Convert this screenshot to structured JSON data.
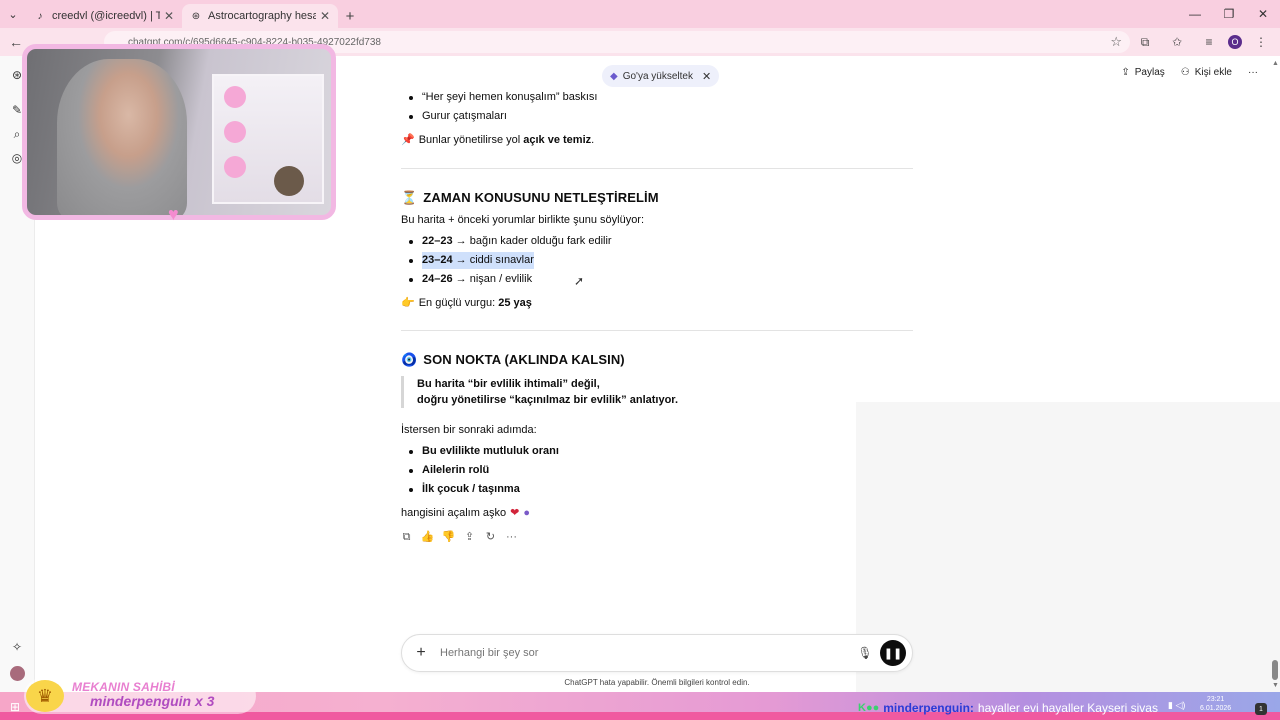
{
  "browser": {
    "tabs": [
      {
        "title": "creedvl (@icreedvl) | TikTok",
        "icon": "tiktok-icon",
        "active": false
      },
      {
        "title": "Astrocartography hesaplama y",
        "icon": "chatgpt-icon",
        "active": true
      }
    ],
    "url": "chatgpt.com/c/695d6645-c904-8224-b035-4927022fd738",
    "profile_letter": "O"
  },
  "header": {
    "upgrade_label": "Go'ya yükseltek",
    "share_label": "Paylaş",
    "add_person_label": "Kişi ekle"
  },
  "content": {
    "pre_bullets": [
      "“Her şeyi hemen konuşalım” baskısı",
      "Gurur çatışmaları"
    ],
    "managed_prefix": "Bunlar yönetilirse yol ",
    "managed_bold": "açık ve temiz",
    "managed_suffix": ".",
    "time_heading": "ZAMAN KONUSUNU NETLEŞTİRELİM",
    "time_intro": "Bu harita + önceki yorumlar birlikte şunu söylüyor:",
    "time_items": [
      {
        "range": "22–23",
        "text": "→ bağın kader olduğu fark edilir"
      },
      {
        "range": "23–24",
        "text": "→ ciddi sınavlar"
      },
      {
        "range": "24–26",
        "text": "→ nişan / evlilik"
      }
    ],
    "emphasis_prefix": "En güçlü vurgu: ",
    "emphasis_bold": "25 yaş",
    "last_heading": "SON NOKTA (AKLINDA KALSIN)",
    "quote_line1": "Bu harita “bir evlilik ihtimali” değil,",
    "quote_line2": "doğru yönetilirse “kaçınılmaz bir evlilik” anlatıyor.",
    "next_intro": "İstersen bir sonraki adımda:",
    "next_items": [
      "Bu evlilikte mutluluk oranı",
      "Ailelerin rolü",
      "İlk çocuk / taşınma"
    ],
    "closing": "hangisini açalım aşko"
  },
  "composer": {
    "placeholder": "Herhangi bir şey sor",
    "disclaimer": "ChatGPT hata yapabilir. Önemli bilgileri kontrol edin."
  },
  "overlay": {
    "owner_title": "MEKANIN SAHİBİ",
    "owner_name": "minderpenguin x 3",
    "ticker_user": "minderpenguin:",
    "ticker_msg": "hayaller evi hayaller Kayseri sivas",
    "clock_time": "23:21",
    "clock_date": "6.01.2026",
    "notif_count": "1"
  },
  "colors": {
    "tabbar": "#f9cfe0",
    "highlight": "#cfe0fb",
    "webcam_border": "#f2b8e3"
  }
}
